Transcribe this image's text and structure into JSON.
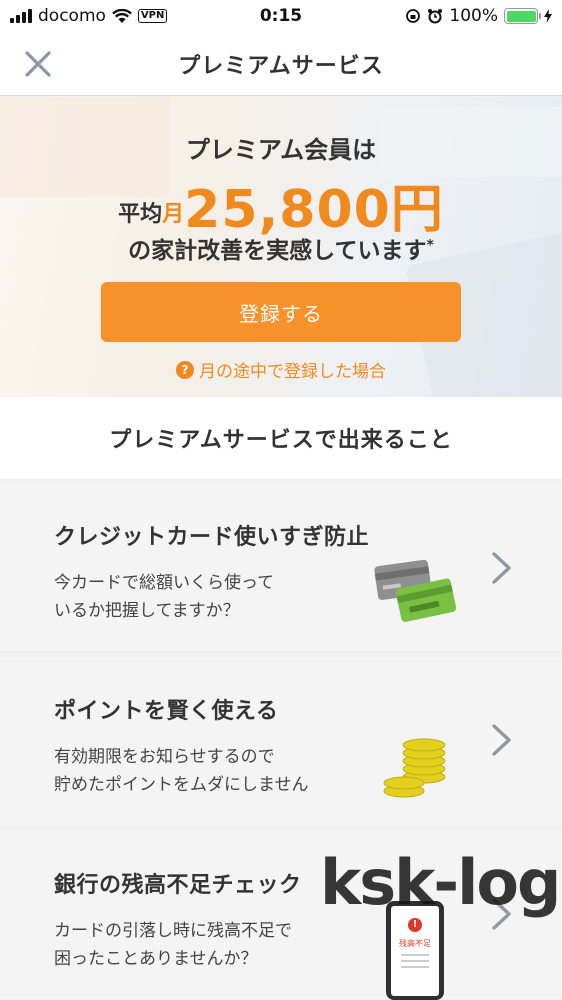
{
  "status_bar": {
    "carrier": "docomo",
    "vpn": "VPN",
    "time": "0:15",
    "battery": "100%"
  },
  "nav": {
    "title": "プレミアムサービス"
  },
  "hero": {
    "line1": "プレミアム会員は",
    "prefix": "平均",
    "month": "月",
    "amount": "25,800円",
    "line3": "の家計改善を実感しています",
    "asterisk": "*",
    "register_label": "登録する",
    "help_icon": "?",
    "help_label": "月の途中で登録した場合"
  },
  "section": {
    "heading": "プレミアムサービスで出来ること"
  },
  "features": [
    {
      "title": "クレジットカード使いすぎ防止",
      "desc1": "今カードで総額いくら使って",
      "desc2": "いるか把握してますか？"
    },
    {
      "title": "ポイントを賢く使える",
      "desc1": "有効期限をお知らせするので",
      "desc2": "貯めたポイントをムダにしません"
    },
    {
      "title": "銀行の残高不足チェック",
      "desc1": "カードの引落し時に残高不足で",
      "desc2": "困ったことありませんか？",
      "badge": "残高不足"
    }
  ],
  "watermark": "ksk-log",
  "colors": {
    "accent": "#f08a1e",
    "button": "#f7922a",
    "card_bg": "#f4f4f4"
  }
}
